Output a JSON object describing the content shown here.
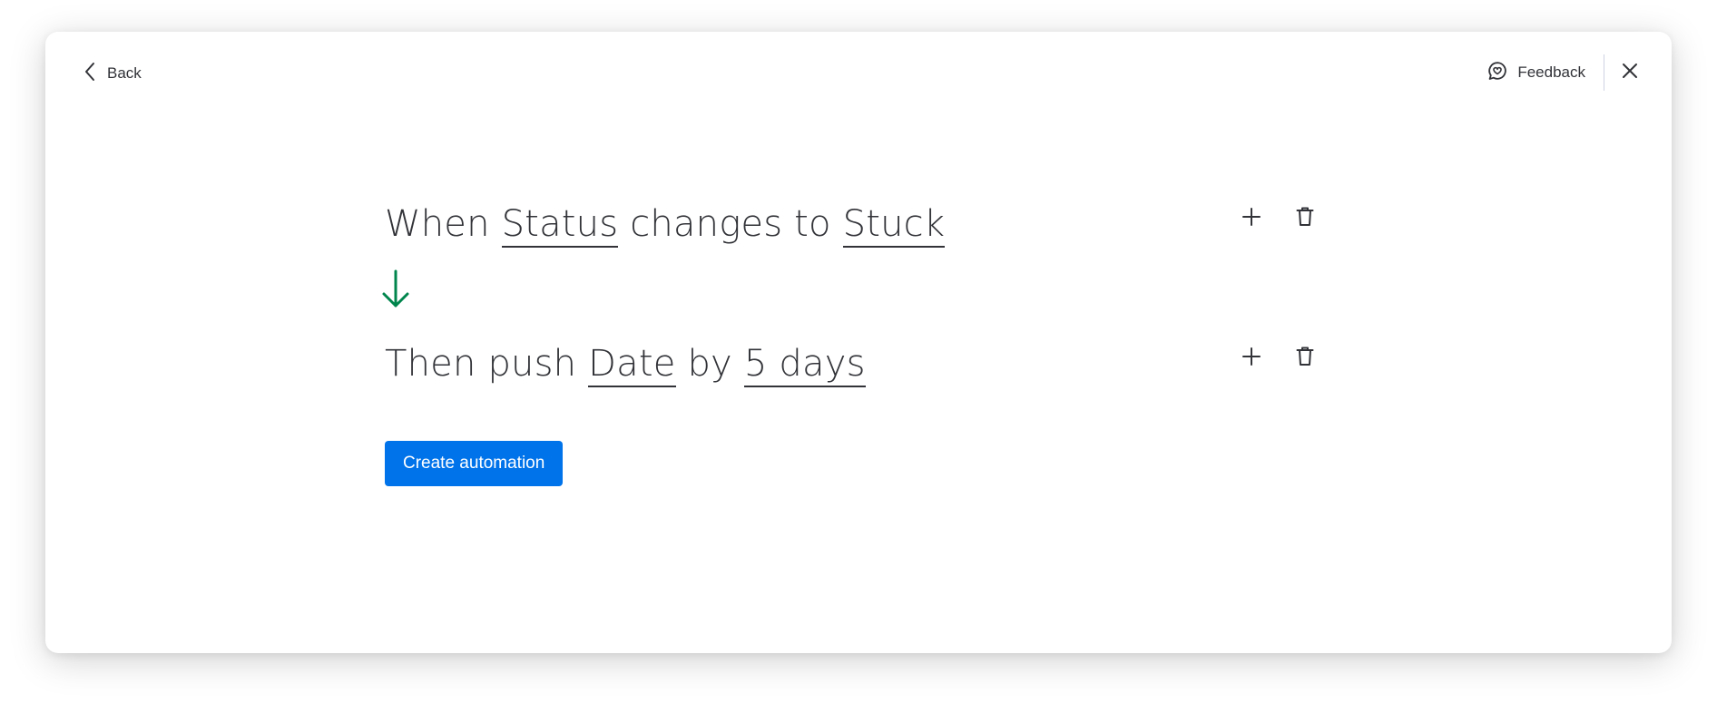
{
  "header": {
    "back_label": "Back",
    "feedback_label": "Feedback"
  },
  "recipe": {
    "trigger": {
      "prefix": "When",
      "field": "Status",
      "middle": "changes to",
      "value": "Stuck"
    },
    "action": {
      "prefix": "Then push",
      "field": "Date",
      "middle": "by",
      "value": "5 days"
    }
  },
  "cta": {
    "label": "Create automation"
  },
  "icons": {
    "back": "chevron-left-icon",
    "feedback": "feedback-chat-icon",
    "close": "close-icon",
    "add": "plus-icon",
    "delete": "trash-icon",
    "flow": "arrow-down-icon"
  },
  "colors": {
    "accent": "#0073ea",
    "arrow": "#00854d",
    "text": "#323338"
  }
}
